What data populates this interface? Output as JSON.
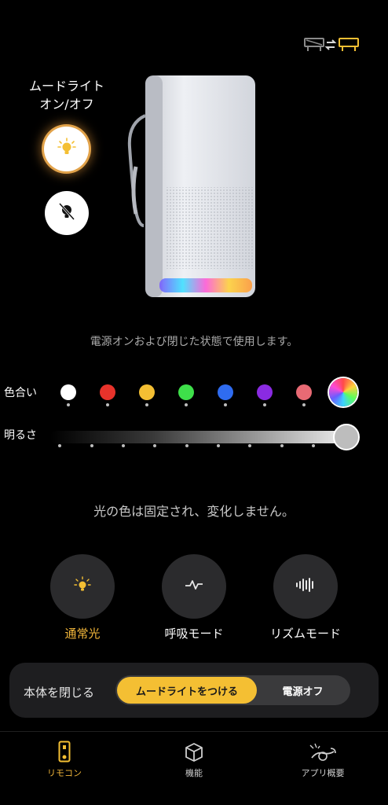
{
  "mood_light": {
    "title_line1": "ムードライト",
    "title_line2": "オン/オフ",
    "on_icon": "lightbulb-on-icon",
    "off_icon": "lightbulb-off-icon"
  },
  "header": {
    "swap_icon": "device-swap-icon"
  },
  "captions": {
    "usage": "電源オンおよび閉じた状態で使用します。",
    "mode_desc": "光の色は固定され、変化しません。"
  },
  "color": {
    "label": "色合い",
    "swatches": [
      "#ffffff",
      "#e8332b",
      "#f4bf33",
      "#3ee04a",
      "#2f6cf0",
      "#8a2be2",
      "#e86a74"
    ],
    "selected": "rainbow"
  },
  "brightness": {
    "label": "明るさ",
    "level_percent": 100
  },
  "modes": [
    {
      "label": "通常光",
      "icon": "lightbulb-icon",
      "active": true
    },
    {
      "label": "呼吸モード",
      "icon": "pulse-wave-icon",
      "active": false
    },
    {
      "label": "リズムモード",
      "icon": "sound-wave-icon",
      "active": false
    }
  ],
  "close_body": {
    "label": "本体を閉じる",
    "option_active": "ムードライトをつける",
    "option_inactive": "電源オフ"
  },
  "tabs": [
    {
      "label": "リモコン",
      "icon": "remote-icon",
      "active": true
    },
    {
      "label": "機能",
      "icon": "cube-icon",
      "active": false
    },
    {
      "label": "アプリ概要",
      "icon": "app-info-icon",
      "active": false
    }
  ],
  "colors": {
    "accent": "#f4bf33",
    "background": "#000000"
  }
}
